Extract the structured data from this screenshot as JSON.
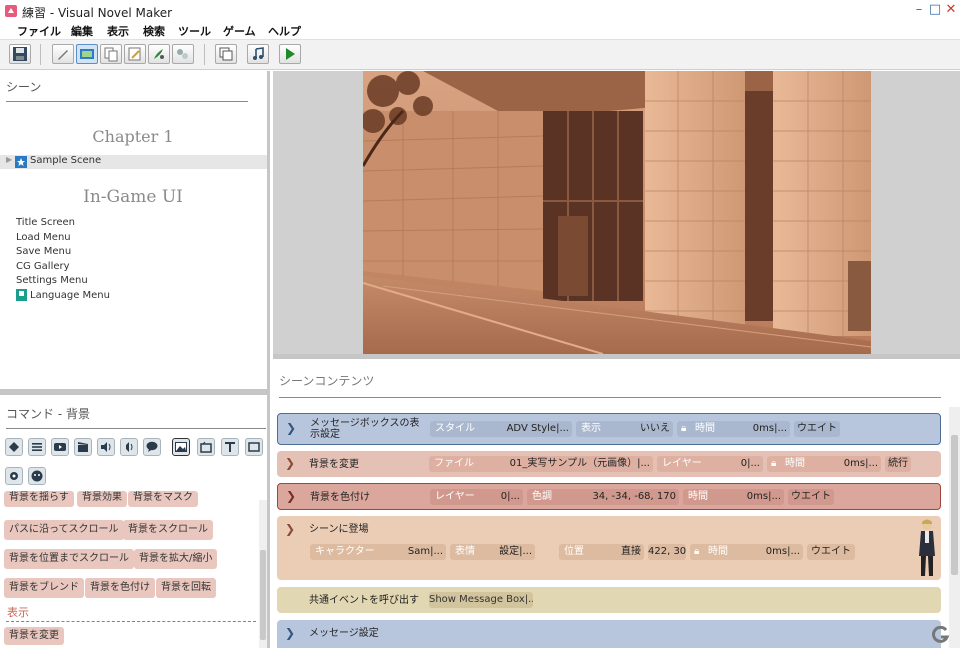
{
  "window": {
    "title": "練習 - Visual Novel Maker",
    "minimize": "–",
    "maximize": "□",
    "close": "✕"
  },
  "menu": [
    "ファイル",
    "編集",
    "表示",
    "検索",
    "ツール",
    "ゲーム",
    "ヘルプ"
  ],
  "toolbar": {
    "buttons": [
      "save-icon",
      "pen-icon",
      "layout-icon",
      "copy-icon",
      "edit-icon",
      "brush-icon",
      "blocks-icon",
      "database-icon",
      "music-icon",
      "play-icon"
    ],
    "accent": "#1f8a2c"
  },
  "scene_panel": {
    "header": "シーン",
    "chapter": "Chapter 1",
    "scene": "Sample Scene",
    "ingame_header": "In-Game UI",
    "ui_items": [
      "Title Screen",
      "Load Menu",
      "Save Menu",
      "CG Gallery",
      "Settings Menu",
      "Language Menu"
    ]
  },
  "command_panel": {
    "header": "コマンド - 背景",
    "icons": [
      "add-icon",
      "list-icon",
      "video-icon",
      "clapper-icon",
      "sound-icon",
      "voice-icon",
      "message-icon",
      "picture-icon",
      "box-icon",
      "text-icon",
      "window-icon",
      "gear-icon",
      "face-icon"
    ],
    "buttons_row1": [
      "背景を揺らす",
      "背景効果",
      "背景をマスク"
    ],
    "buttons_row2": [
      "パスに沿ってスクロール",
      "背景をスクロール"
    ],
    "buttons_row3": [
      "背景を位置までスクロール",
      "背景を拡大/縮小"
    ],
    "buttons_row4": [
      "背景をブレンド",
      "背景を色付け",
      "背景を回転"
    ],
    "section_display": "表示",
    "buttons_row5": [
      "背景を変更"
    ]
  },
  "content_panel": {
    "header": "シーンコンテンツ",
    "rows": [
      {
        "name": "メッセージボックスの表示設定",
        "params": [
          {
            "k": "スタイル",
            "v": "ADV Style|..."
          },
          {
            "k": "表示",
            "v": "いいえ"
          },
          {
            "k": "時間",
            "v": "0ms|..."
          },
          {
            "k": "",
            "v": "ウエイト"
          }
        ]
      },
      {
        "name": "背景を変更",
        "params": [
          {
            "k": "ファイル",
            "v": "01_実写サンプル（元画像）|..."
          },
          {
            "k": "レイヤー",
            "v": "0|..."
          },
          {
            "k": "時間",
            "v": "0ms|..."
          },
          {
            "k": "",
            "v": "続行"
          }
        ]
      },
      {
        "name": "背景を色付け",
        "params": [
          {
            "k": "レイヤー",
            "v": "0|..."
          },
          {
            "k": "色調",
            "v": "34, -34, -68, 170"
          },
          {
            "k": "時間",
            "v": "0ms|..."
          },
          {
            "k": "",
            "v": "ウエイト"
          }
        ]
      },
      {
        "name": "シーンに登場",
        "params": [
          {
            "k": "キャラクター",
            "v": "Sam|..."
          },
          {
            "k": "表情",
            "v": "設定|..."
          },
          {
            "k": "位置",
            "v": "直接"
          },
          {
            "k": "",
            "v": "422, 30"
          },
          {
            "k": "時間",
            "v": "0ms|..."
          },
          {
            "k": "",
            "v": "ウエイト"
          }
        ]
      },
      {
        "name": "共通イベントを呼び出す",
        "params": [
          {
            "k": "",
            "v": "Show Message Box|..."
          }
        ]
      },
      {
        "name": "メッセージ設定",
        "params": []
      }
    ]
  },
  "colors": {
    "row_blue": "#b8c6dd",
    "row_brown": "#e5c1b5",
    "row_rose": "#dba79c",
    "row_tan": "#ebcdb6",
    "row_olive": "#e2d7b3",
    "selected_scene_bg": "#e6e6e6",
    "command_button": "#e9c7be"
  }
}
